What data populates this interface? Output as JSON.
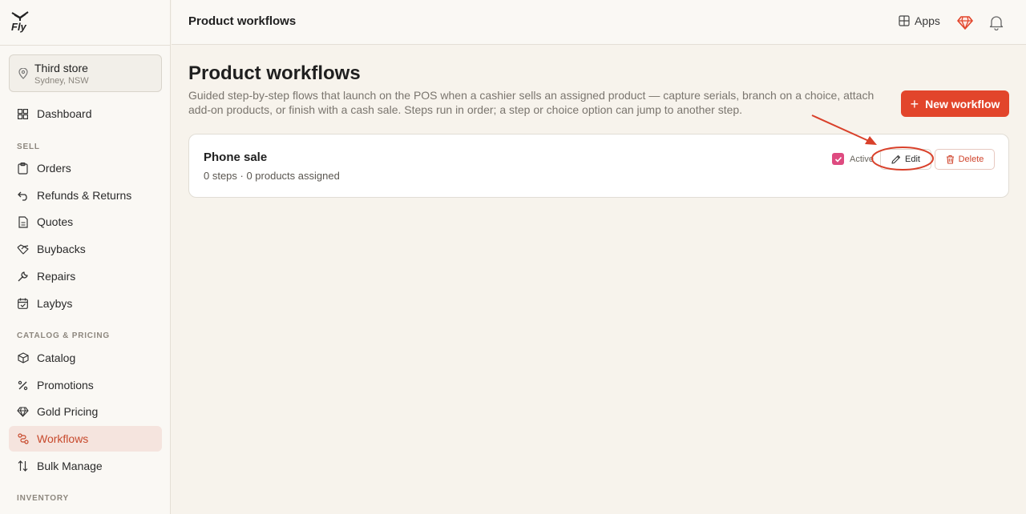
{
  "brand": {
    "logo_text": "Fly"
  },
  "store": {
    "name": "Third store",
    "location": "Sydney, NSW"
  },
  "sidebar": {
    "top_items": [
      {
        "label": "Dashboard",
        "icon": "dashboard-icon"
      }
    ],
    "sections": [
      {
        "title": "SELL",
        "items": [
          {
            "label": "Orders",
            "icon": "clipboard-icon"
          },
          {
            "label": "Refunds & Returns",
            "icon": "undo-icon"
          },
          {
            "label": "Quotes",
            "icon": "document-icon"
          },
          {
            "label": "Buybacks",
            "icon": "handshake-icon"
          },
          {
            "label": "Repairs",
            "icon": "wrench-icon"
          },
          {
            "label": "Laybys",
            "icon": "calendar-icon"
          }
        ]
      },
      {
        "title": "CATALOG & PRICING",
        "items": [
          {
            "label": "Catalog",
            "icon": "package-icon"
          },
          {
            "label": "Promotions",
            "icon": "percent-icon"
          },
          {
            "label": "Gold Pricing",
            "icon": "gem-icon"
          },
          {
            "label": "Workflows",
            "icon": "workflow-icon",
            "active": true
          },
          {
            "label": "Bulk Manage",
            "icon": "sort-arrows-icon"
          }
        ]
      },
      {
        "title": "INVENTORY",
        "items": []
      }
    ]
  },
  "topbar": {
    "title": "Product workflows",
    "apps_label": "Apps"
  },
  "main": {
    "title": "Product workflows",
    "description": "Guided step-by-step flows that launch on the POS when a cashier sells an assigned product — capture serials, branch on a choice, attach add-on products, or finish with a cash sale. Steps run in order; a step or choice option can jump to another step.",
    "new_button_label": "New workflow",
    "workflows": [
      {
        "name": "Phone sale",
        "meta": "0 steps · 0 products assigned",
        "active_label": "Active",
        "active": true,
        "edit_label": "Edit",
        "delete_label": "Delete"
      }
    ]
  },
  "colors": {
    "accent": "#e2452b",
    "checkbox": "#de4b80",
    "annotation": "#d9402a",
    "active_nav_bg": "#f5e4de"
  }
}
